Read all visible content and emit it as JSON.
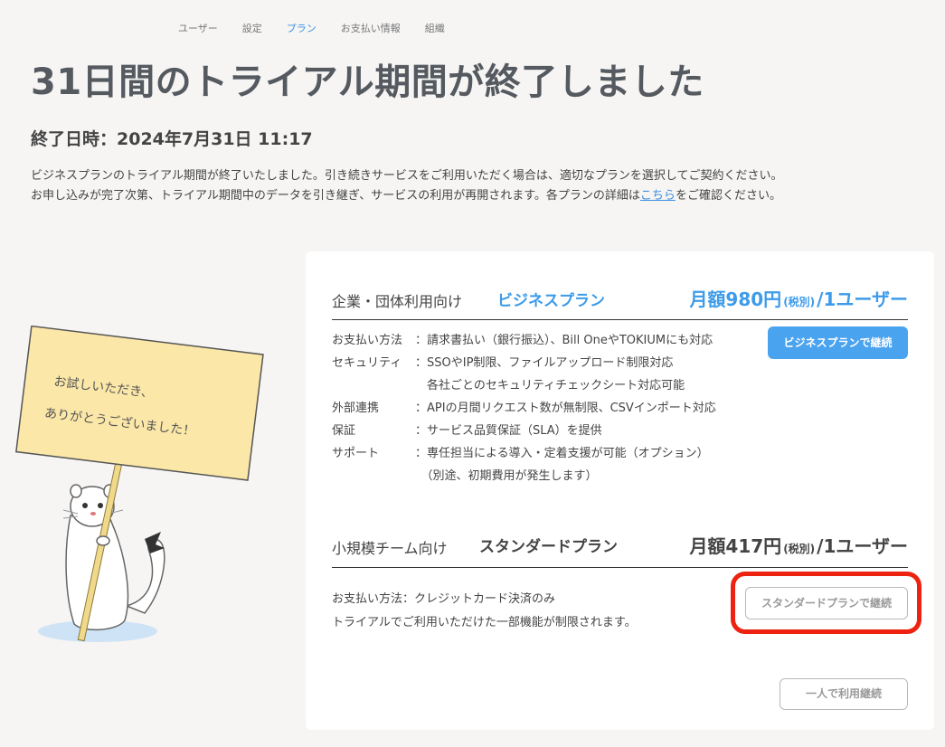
{
  "nav": {
    "items": [
      "ユーザー",
      "設定",
      "プラン",
      "お支払い情報",
      "組織"
    ],
    "active": "プラン"
  },
  "page": {
    "title": "31日間のトライアル期間が終了しました",
    "end_label": "終了日時：2024年7月31日 11:17",
    "desc_line1": "ビジネスプランのトライアル期間が終了いたしました。引き続きサービスをご利用いただく場合は、適切なプランを選択してご契約ください。",
    "desc_line2_pre": "お申し込みが完了次第、トライアル期間中のデータを引き継ぎ、サービスの利用が再開されます。各プランの詳細は",
    "desc_link": "こちら",
    "desc_line2_post": "をご確認ください。"
  },
  "illustration": {
    "sign_line1": "お試しいただき、",
    "sign_line2": "ありがとうございました！"
  },
  "business": {
    "audience": "企業・団体利用向け",
    "name": "ビジネスプラン",
    "price_main": "月額980円",
    "price_tax": "(税別)",
    "price_unit": "/1ユーザー",
    "features": [
      {
        "k": "お支払い方法",
        "v": "：請求書払い（銀行振込）、Bill OneやTOKIUMにも対応"
      },
      {
        "k": "セキュリティ",
        "v": "：SSOやIP制限、ファイルアップロード制限対応"
      },
      {
        "k": "",
        "v": "　各社ごとのセキュリティチェックシート対応可能"
      },
      {
        "k": "外部連携",
        "v": "：APIの月間リクエスト数が無制限、CSVインポート対応"
      },
      {
        "k": "保証",
        "v": "：サービス品質保証（SLA）を提供"
      },
      {
        "k": "サポート",
        "v": "：専任担当による導入・定着支援が可能（オプション）"
      },
      {
        "k": "",
        "v": "　（別途、初期費用が発生します）"
      }
    ],
    "button": "ビジネスプランで継続",
    "color": "#4aa3ef"
  },
  "standard": {
    "audience": "小規模チーム向け",
    "name": "スタンダードプラン",
    "price_main": "月額417円",
    "price_tax": "(税別)",
    "price_unit": "/1ユーザー",
    "feature_line1": "お支払い方法：クレジットカード決済のみ",
    "feature_line2": "トライアルでご利用いただけた一部機能が制限されます。",
    "button": "スタンダードプランで継続"
  },
  "solo_button": "一人で利用継続",
  "highlight_color": "#ee2211"
}
